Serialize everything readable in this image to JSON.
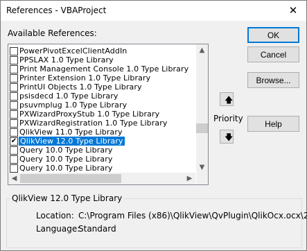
{
  "window": {
    "title": "References - VBAProject",
    "close_glyph": "✕"
  },
  "available_label": "Available References:",
  "references": [
    {
      "label": "PowerPivotExcelClientAddIn",
      "checked": false
    },
    {
      "label": "PPSLAX 1.0 Type Library",
      "checked": false
    },
    {
      "label": "Print Management Console 1.0 Type Library",
      "checked": false
    },
    {
      "label": "Printer Extension 1.0 Type Library",
      "checked": false
    },
    {
      "label": "PrintUI Objects 1.0 Type Library",
      "checked": false
    },
    {
      "label": "psisdecd 1.0 Type Library",
      "checked": false
    },
    {
      "label": "psuvmplug 1.0 Type Library",
      "checked": false
    },
    {
      "label": "PXWizardProxyStub 1.0 Type Library",
      "checked": false
    },
    {
      "label": "PXWizardRegistration 1.0 Type Library",
      "checked": false
    },
    {
      "label": "QlikView 11.0 Type Library",
      "checked": false
    },
    {
      "label": "QlikView 12.0 Type Library",
      "checked": true,
      "selected": true
    },
    {
      "label": "Query 10.0 Type Library",
      "checked": false
    },
    {
      "label": "Query 10.0 Type Library",
      "checked": false
    },
    {
      "label": "Query 10.0 Type Library",
      "checked": false
    }
  ],
  "buttons": {
    "ok": "OK",
    "cancel": "Cancel",
    "browse": "Browse...",
    "help": "Help"
  },
  "priority": {
    "label": "Priority",
    "up_glyph": "🡅",
    "down_glyph": "🡇"
  },
  "details": {
    "title": "QlikView 12.0 Type Library",
    "location_label": "Location:",
    "location_value": "C:\\Program Files (x86)\\QlikView\\QvPlugin\\QlikOcx.ocx\\2",
    "language_label": "Language:",
    "language_value": "Standard"
  },
  "icons": {
    "check": "✔",
    "scroll_up": "▲",
    "scroll_down": "▼",
    "scroll_left": "◀",
    "scroll_right": "▶"
  },
  "colors": {
    "selection": "#0078d7",
    "default_button_border": "#0078d7"
  }
}
